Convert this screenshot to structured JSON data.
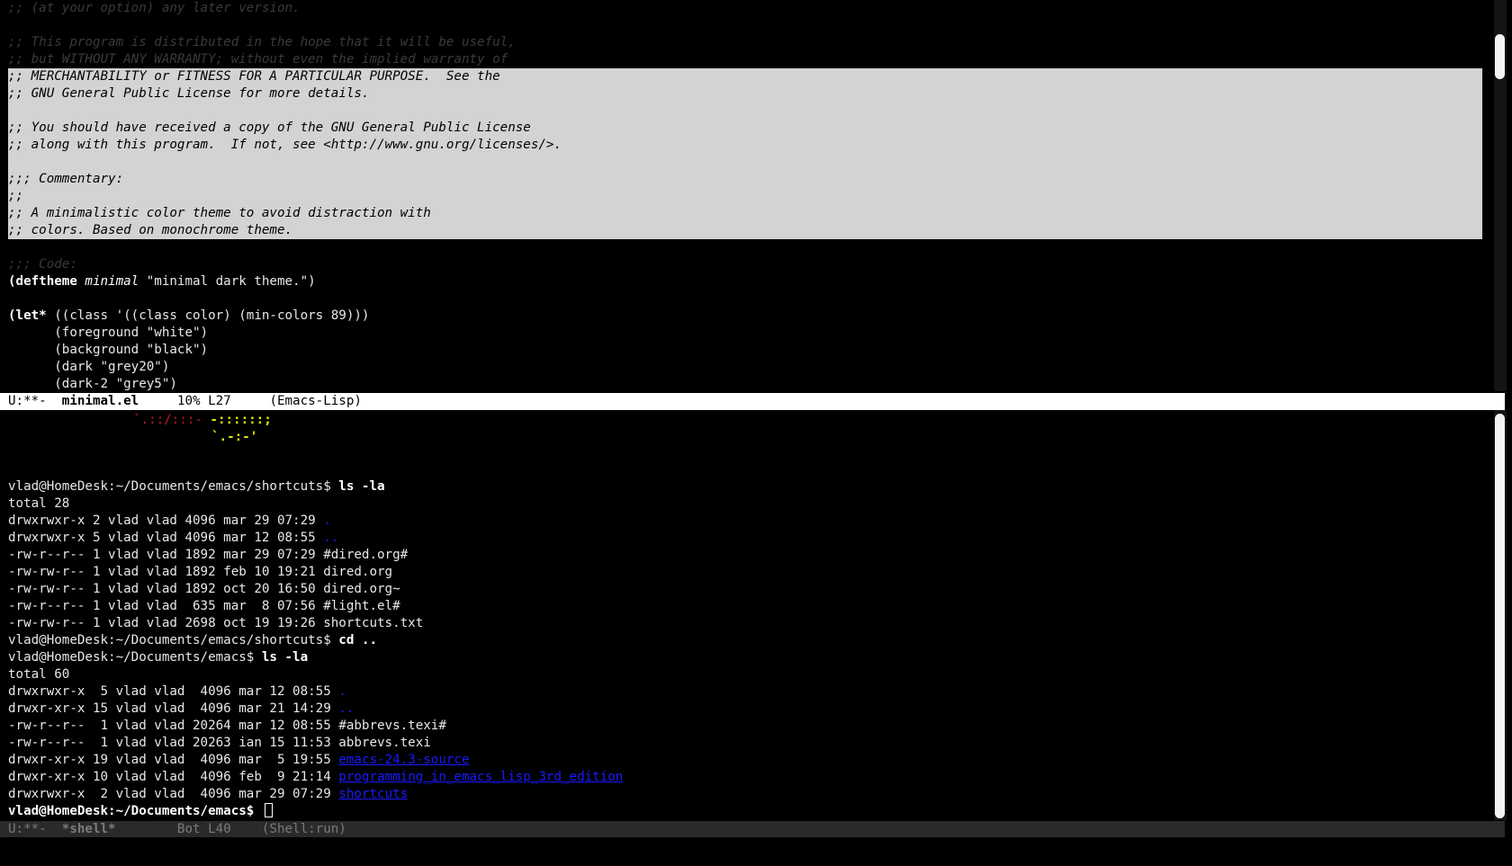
{
  "editor": {
    "header_comments": [
      ";; (at your option) any later version.",
      "",
      ";; This program is distributed in the hope that it will be useful,",
      ";; but WITHOUT ANY WARRANTY; without even the implied warranty of"
    ],
    "selected_lines": [
      ";; MERCHANTABILITY or FITNESS FOR A PARTICULAR PURPOSE.  See the",
      ";; GNU General Public License for more details.",
      "",
      ";; You should have received a copy of the GNU General Public License",
      ";; along with this program.  If not, see <http://www.gnu.org/licenses/>.",
      "",
      ";;; Commentary:",
      ";;",
      ";; A minimalistic color theme to avoid distraction with",
      ";; colors. Based on monochrome theme."
    ],
    "code_comment": ";;; Code:",
    "deftheme": {
      "keyword": "(deftheme",
      "name": "minimal",
      "rest": " \"minimal dark theme.\")"
    },
    "let": {
      "keyword": "(let*",
      "rest": " ((class '((class color) (min-colors 89)))"
    },
    "let_bindings": [
      "      (foreground \"white\")",
      "      (background \"black\")",
      "      (dark \"grey20\")",
      "      (dark-2 \"grey5\")"
    ],
    "modeline": {
      "state": "U:**-  ",
      "buffer": "minimal.el",
      "position": "     10% L27     ",
      "mode": "(Emacs-Lisp)"
    }
  },
  "shell": {
    "ascii_art": {
      "red": "`.::/:::-",
      "yellow": "-::::::;",
      "yellow2": "`.-:-'"
    },
    "prompt1": {
      "path": "vlad@HomeDesk:~/Documents/emacs/shortcuts$ ",
      "cmd": "ls -la"
    },
    "total1": "total 28",
    "listing1": [
      {
        "meta": "drwxrwxr-x 2 vlad vlad 4096 mar 29 07:29 ",
        "name": ".",
        "style": "dir"
      },
      {
        "meta": "drwxrwxr-x 5 vlad vlad 4096 mar 12 08:55 ",
        "name": "..",
        "style": "dir"
      },
      {
        "meta": "-rw-r--r-- 1 vlad vlad 1892 mar 29 07:29 ",
        "name": "#dired.org#",
        "style": "file"
      },
      {
        "meta": "-rw-rw-r-- 1 vlad vlad 1892 feb 10 19:21 ",
        "name": "dired.org",
        "style": "file"
      },
      {
        "meta": "-rw-rw-r-- 1 vlad vlad 1892 oct 20 16:50 ",
        "name": "dired.org~",
        "style": "file"
      },
      {
        "meta": "-rw-r--r-- 1 vlad vlad  635 mar  8 07:56 ",
        "name": "#light.el#",
        "style": "file"
      },
      {
        "meta": "-rw-rw-r-- 1 vlad vlad 2698 oct 19 19:26 ",
        "name": "shortcuts.txt",
        "style": "file"
      }
    ],
    "prompt2": {
      "path": "vlad@HomeDesk:~/Documents/emacs/shortcuts$ ",
      "cmd": "cd .."
    },
    "prompt3": {
      "path": "vlad@HomeDesk:~/Documents/emacs$ ",
      "cmd": "ls -la"
    },
    "total2": "total 60",
    "listing2": [
      {
        "meta": "drwxrwxr-x  5 vlad vlad  4096 mar 12 08:55 ",
        "name": ".",
        "style": "dir"
      },
      {
        "meta": "drwxr-xr-x 15 vlad vlad  4096 mar 21 14:29 ",
        "name": "..",
        "style": "dir"
      },
      {
        "meta": "-rw-r--r--  1 vlad vlad 20264 mar 12 08:55 ",
        "name": "#abbrevs.texi#",
        "style": "file"
      },
      {
        "meta": "-rw-r--r--  1 vlad vlad 20263 ian 15 11:53 ",
        "name": "abbrevs.texi",
        "style": "file"
      },
      {
        "meta": "drwxr-xr-x 19 vlad vlad  4096 mar  5 19:55 ",
        "name": "emacs-24.3-source",
        "style": "dirlink"
      },
      {
        "meta": "drwxr-xr-x 10 vlad vlad  4096 feb  9 21:14 ",
        "name": "programming_in_emacs_lisp_3rd_edition",
        "style": "dirlink"
      },
      {
        "meta": "drwxrwxr-x  2 vlad vlad  4096 mar 29 07:29 ",
        "name": "shortcuts",
        "style": "dirlink"
      }
    ],
    "prompt4": {
      "path": "vlad@HomeDesk:~/Documents/emacs$ "
    },
    "modeline": {
      "state": "U:**-  ",
      "buffer": "*shell*",
      "position": "        Bot L40    ",
      "mode": "(Shell:run)"
    }
  },
  "colors": {
    "background": "#000000",
    "selection": "#d3d3d3",
    "directory": "#1a1aff",
    "modeline_active": "#ffffff"
  }
}
